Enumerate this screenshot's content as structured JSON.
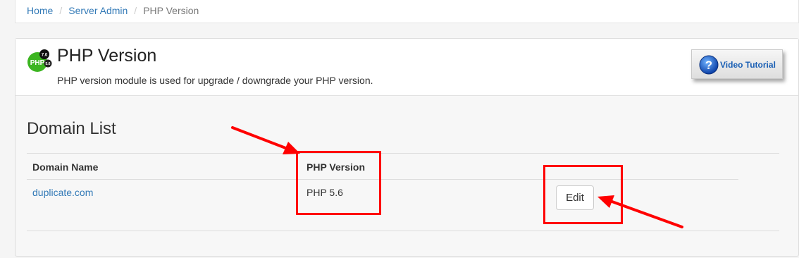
{
  "breadcrumb": {
    "home": "Home",
    "server_admin": "Server Admin",
    "current": "PHP Version",
    "separator": "/"
  },
  "header": {
    "logo_text": "PHP",
    "logo_badge_top": "7.0",
    "logo_badge_side": "5.6",
    "title": "PHP Version",
    "description": "PHP version module is used for upgrade / downgrade your PHP version.",
    "video_button_label": "Video Tutorial",
    "video_icon": "question-icon"
  },
  "domain_list": {
    "title": "Domain List",
    "columns": [
      "Domain Name",
      "PHP Version"
    ],
    "rows": [
      {
        "domain": "duplicate.com",
        "php_version": "PHP 5.6",
        "action": "Edit"
      }
    ]
  },
  "annotation_color": "#ff0000",
  "accent_color": "#337ab7"
}
